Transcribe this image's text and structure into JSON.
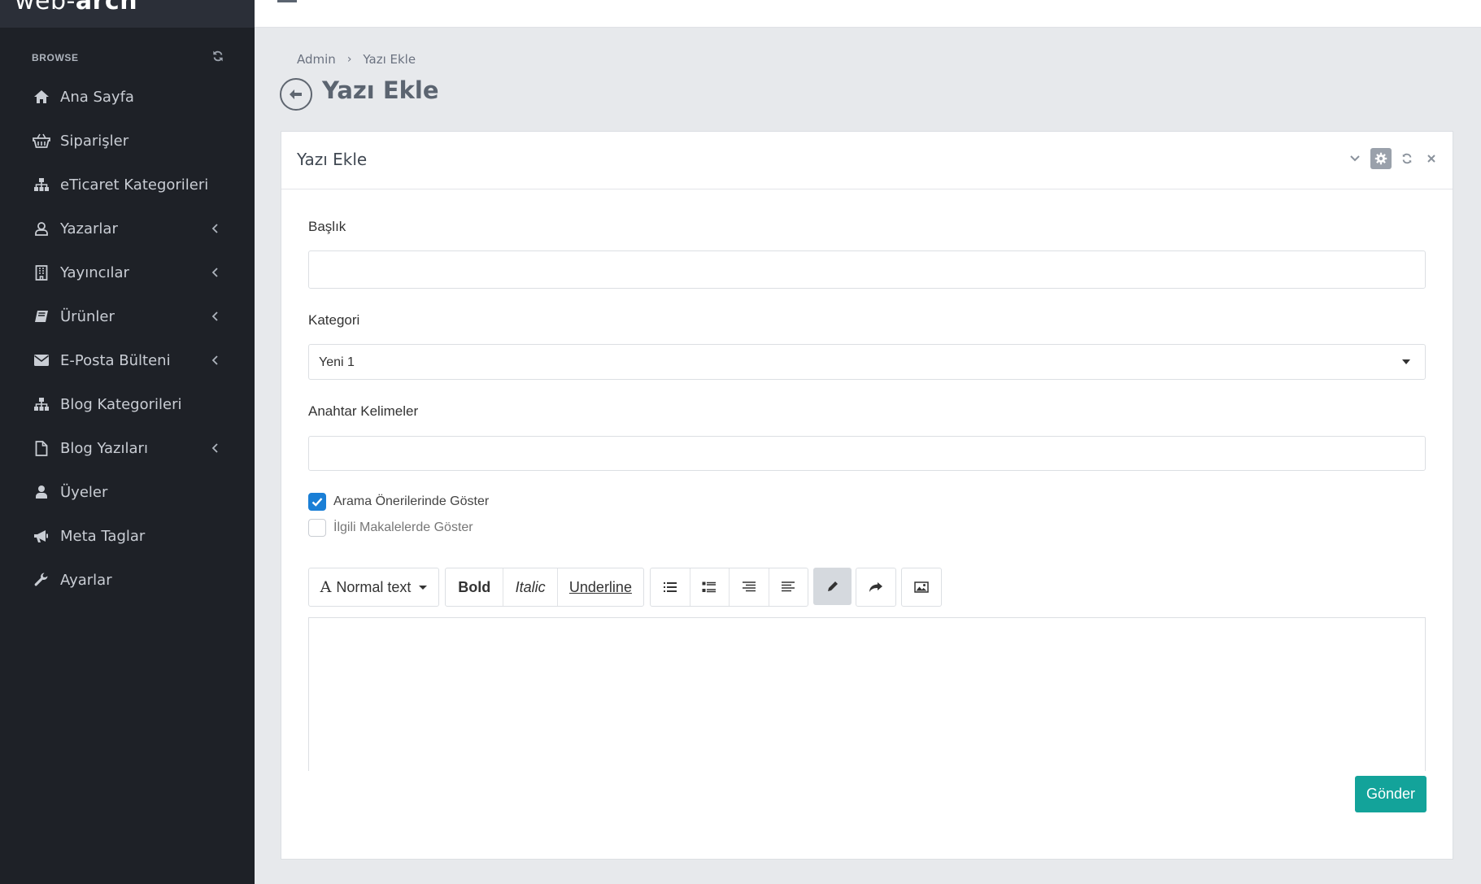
{
  "app": {
    "logo_light": "web-",
    "logo_bold": "arch"
  },
  "sidebar": {
    "section_label": "BROWSE",
    "items": [
      {
        "label": "Ana Sayfa",
        "icon": "home-icon",
        "has_children": false
      },
      {
        "label": "Siparişler",
        "icon": "basket-icon",
        "has_children": false
      },
      {
        "label": "eTicaret Kategorileri",
        "icon": "sitemap-icon",
        "has_children": false
      },
      {
        "label": "Yazarlar",
        "icon": "user-outline-icon",
        "has_children": true
      },
      {
        "label": "Yayıncılar",
        "icon": "building-icon",
        "has_children": true
      },
      {
        "label": "Ürünler",
        "icon": "book-icon",
        "has_children": true
      },
      {
        "label": "E-Posta Bülteni",
        "icon": "envelope-icon",
        "has_children": true
      },
      {
        "label": "Blog Kategorileri",
        "icon": "sitemap-icon",
        "has_children": false
      },
      {
        "label": "Blog Yazıları",
        "icon": "file-icon",
        "has_children": true
      },
      {
        "label": "Üyeler",
        "icon": "user-icon",
        "has_children": false
      },
      {
        "label": "Meta Taglar",
        "icon": "bullhorn-icon",
        "has_children": false
      },
      {
        "label": "Ayarlar",
        "icon": "wrench-icon",
        "has_children": false
      }
    ]
  },
  "breadcrumb": {
    "items": [
      "Admin",
      "Yazı Ekle"
    ]
  },
  "page": {
    "title": "Yazı Ekle"
  },
  "panel": {
    "title": "Yazı Ekle",
    "fields": {
      "title_label": "Başlık",
      "title_value": "",
      "category_label": "Kategori",
      "category_value": "Yeni 1",
      "keywords_label": "Anahtar Kelimeler",
      "keywords_value": ""
    },
    "checkboxes": [
      {
        "label": "Arama Önerilerinde Göster",
        "checked": true
      },
      {
        "label": "İlgili Makalelerde Göster",
        "checked": false
      }
    ],
    "editor": {
      "format_label": "Normal text",
      "bold_label": "Bold",
      "italic_label": "Italic",
      "underline_label": "Underline",
      "content": ""
    },
    "submit_label": "Gönder"
  },
  "colors": {
    "sidebar_bg": "#1e2127",
    "accent_teal": "#13a39a",
    "checkbox_blue": "#1a7fd6"
  }
}
